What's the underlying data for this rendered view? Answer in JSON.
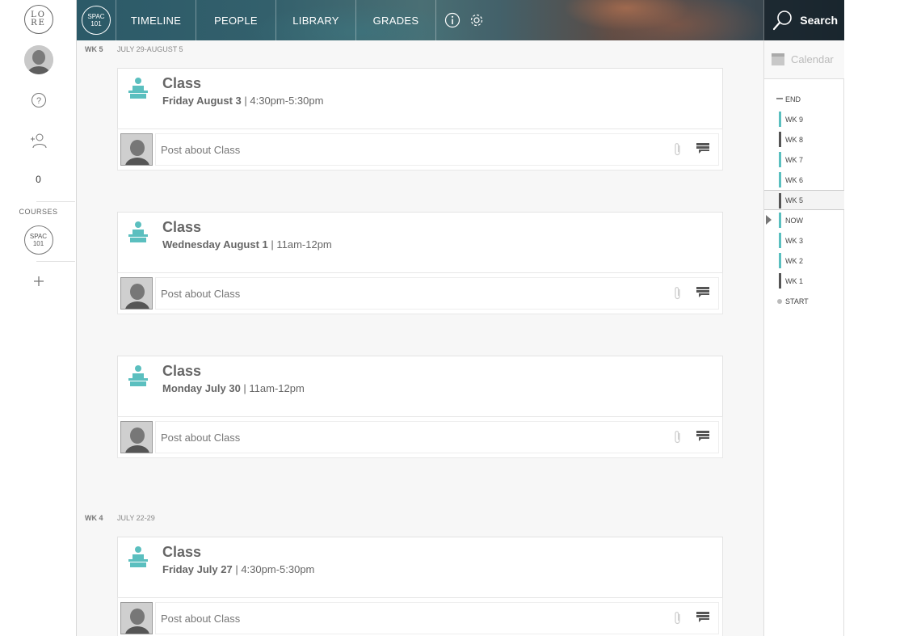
{
  "left_rail": {
    "logo_line1": "LO",
    "logo_line2": "RE",
    "notifications_count": "0",
    "courses_label": "COURSES",
    "course_line1": "SPAC",
    "course_line2": "101"
  },
  "topbar": {
    "course_line1": "SPAC",
    "course_line2": "101",
    "tabs": [
      "TIMELINE",
      "PEOPLE",
      "LIBRARY",
      "GRADES"
    ],
    "search_label": "Search"
  },
  "weeks": [
    {
      "label": "WK 5",
      "range": "JULY 29-AUGUST 5",
      "events": [
        {
          "title": "Class",
          "day": "Friday August 3",
          "time": "4:30pm-5:30pm",
          "post_placeholder": "Post about Class"
        },
        {
          "title": "Class",
          "day": "Wednesday August 1",
          "time": "11am-12pm",
          "post_placeholder": "Post about Class"
        },
        {
          "title": "Class",
          "day": "Monday July 30",
          "time": "11am-12pm",
          "post_placeholder": "Post about Class"
        }
      ]
    },
    {
      "label": "WK 4",
      "range": "JULY 22-29",
      "events": [
        {
          "title": "Class",
          "day": "Friday July 27",
          "time": "4:30pm-5:30pm",
          "post_placeholder": "Post about Class"
        }
      ]
    }
  ],
  "timeline_nav": {
    "calendar_label": "Calendar",
    "items": [
      "END",
      "WK 9",
      "WK 8",
      "WK 7",
      "WK 6",
      "WK 5",
      "NOW",
      "WK 3",
      "WK 2",
      "WK 1",
      "START"
    ]
  },
  "colors": {
    "accent": "#5bbfbf",
    "dark_bar": "#555555"
  }
}
